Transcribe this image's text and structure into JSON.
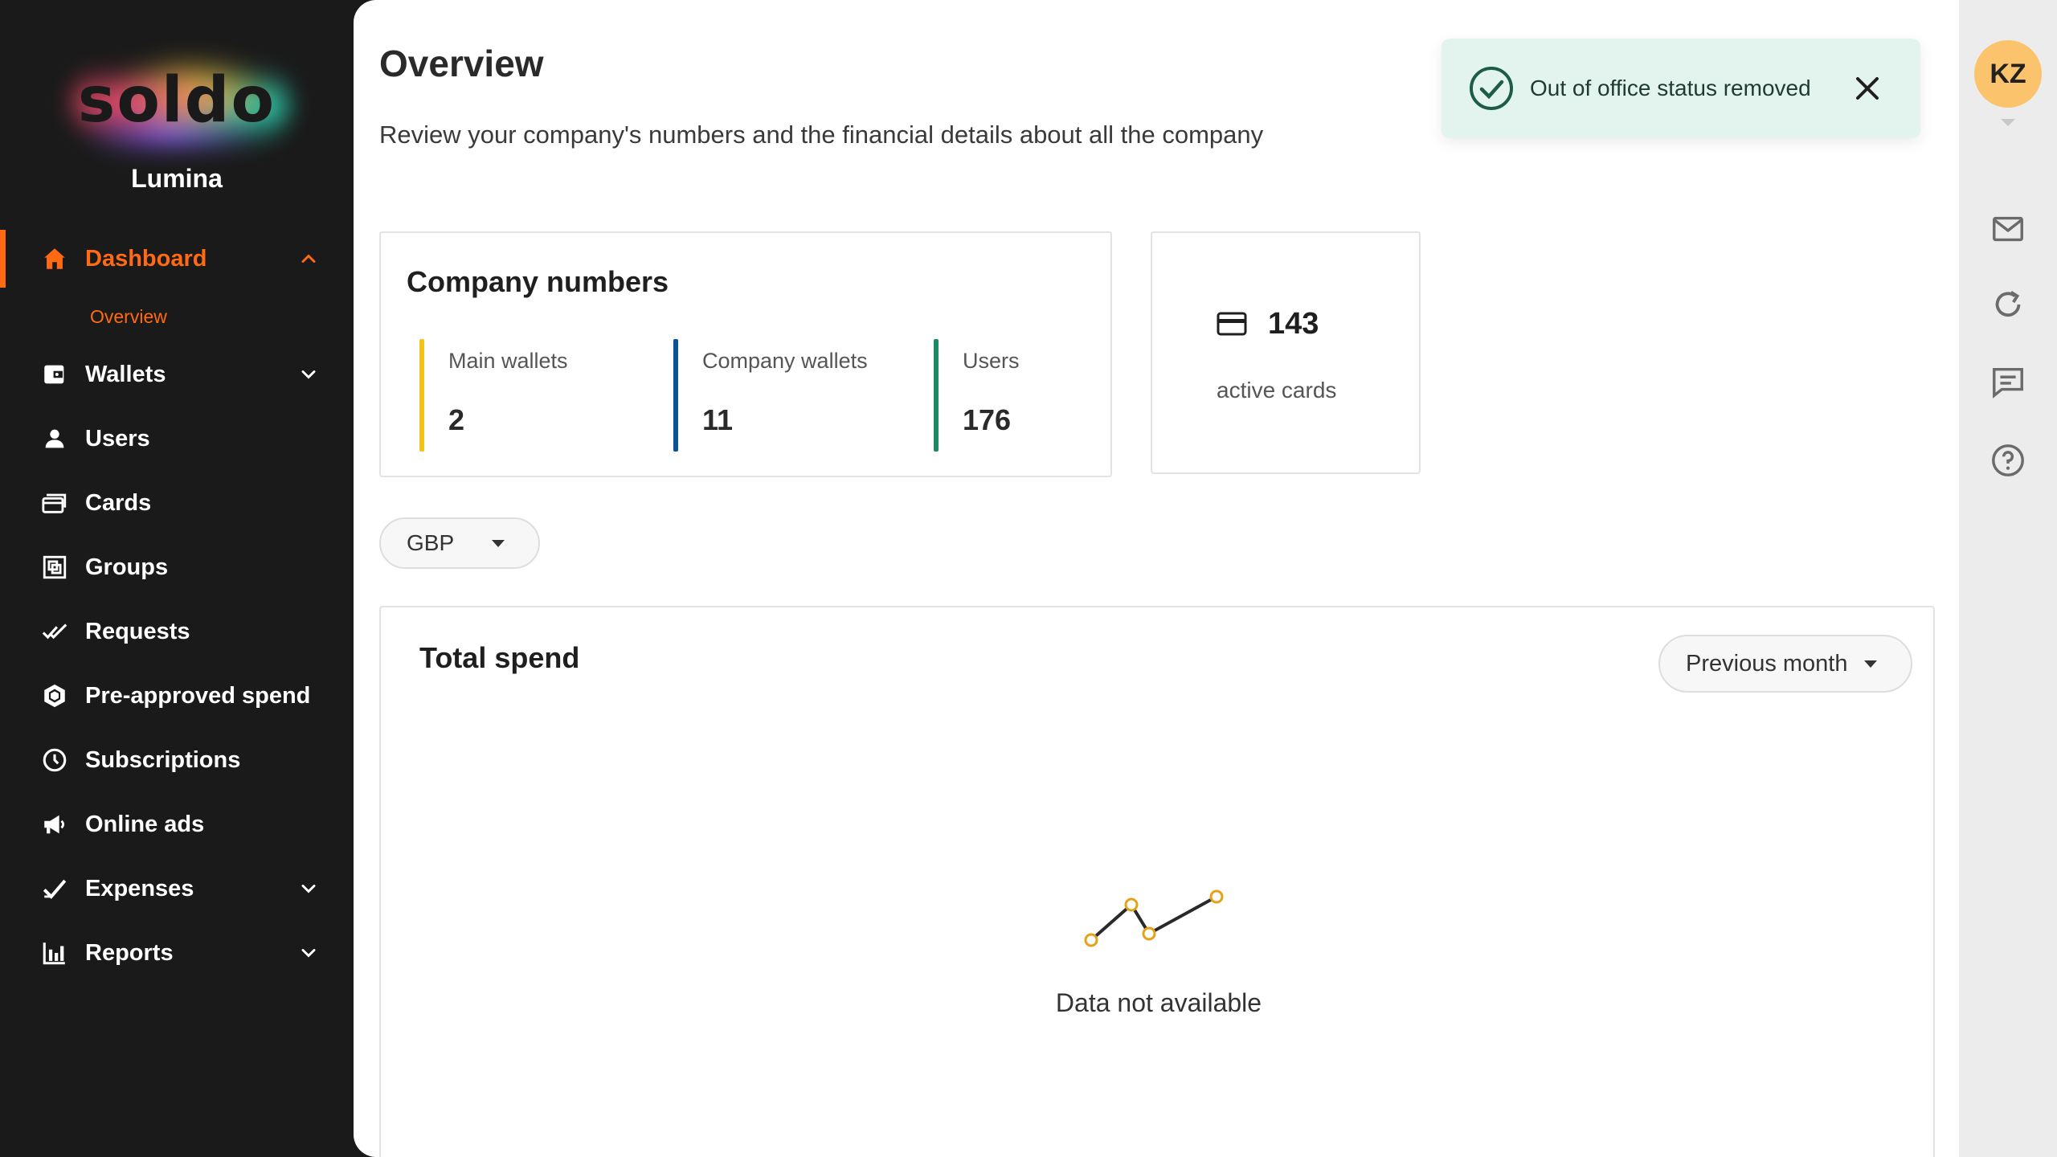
{
  "sidebar": {
    "logo": "soldo",
    "org_name": "Lumina",
    "items": [
      {
        "label": "Dashboard",
        "icon": "home-icon",
        "active": true,
        "expandable": true
      },
      {
        "label": "Wallets",
        "icon": "wallet-icon",
        "expandable": true
      },
      {
        "label": "Users",
        "icon": "user-icon"
      },
      {
        "label": "Cards",
        "icon": "cards-icon"
      },
      {
        "label": "Groups",
        "icon": "groups-icon"
      },
      {
        "label": "Requests",
        "icon": "double-check-icon"
      },
      {
        "label": "Pre-approved spend",
        "icon": "hexagon-icon"
      },
      {
        "label": "Subscriptions",
        "icon": "clock-icon"
      },
      {
        "label": "Online ads",
        "icon": "megaphone-icon"
      },
      {
        "label": "Expenses",
        "icon": "check-icon",
        "expandable": true
      },
      {
        "label": "Reports",
        "icon": "bar-chart-icon",
        "expandable": true
      }
    ],
    "sub_items": {
      "dashboard": [
        "Overview"
      ]
    }
  },
  "page": {
    "title": "Overview",
    "description": "Review your company's numbers and the financial details about all the company"
  },
  "company_numbers": {
    "title": "Company numbers",
    "stats": [
      {
        "label": "Main wallets",
        "value": "2",
        "color": "#f2c318"
      },
      {
        "label": "Company wallets",
        "value": "11",
        "color": "#0b5394"
      },
      {
        "label": "Users",
        "value": "176",
        "color": "#1b8a64"
      }
    ]
  },
  "active_cards": {
    "count": "143",
    "label": "active cards"
  },
  "currency_select": {
    "value": "GBP"
  },
  "total_spend": {
    "title": "Total spend",
    "period": "Previous month",
    "empty_message": "Data not available"
  },
  "toast": {
    "message": "Out of office status removed"
  },
  "rail": {
    "avatar_initials": "KZ",
    "buttons": [
      "mail-icon",
      "refresh-icon",
      "chat-icon",
      "help-icon"
    ]
  },
  "colors": {
    "accent": "#ff6a13",
    "sidebar_bg": "#1a1a1a",
    "toast_bg": "#e3f4ee",
    "toast_icon": "#1e5c48",
    "avatar_bg": "#fbc36b",
    "chart_point": "#e5a11a"
  }
}
